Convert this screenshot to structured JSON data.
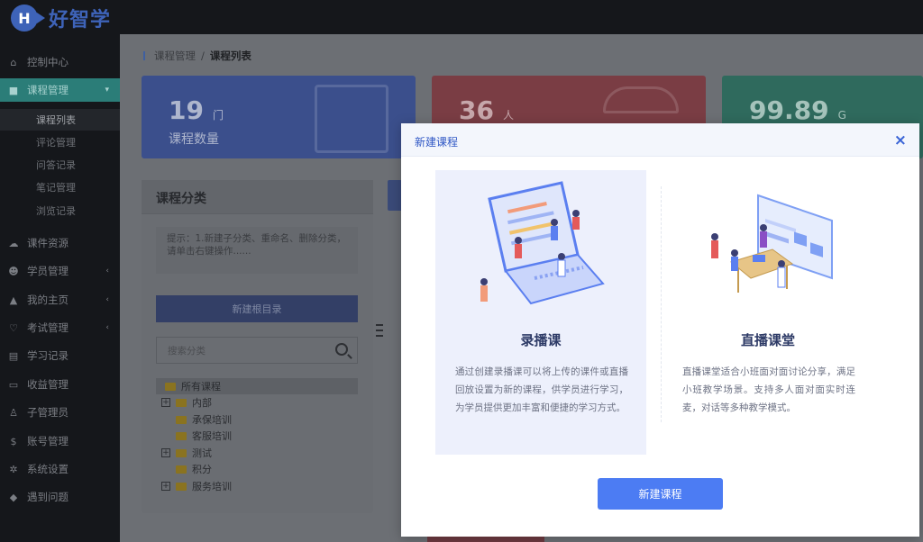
{
  "app": {
    "logo_letter": "H",
    "name": "好智学"
  },
  "sidebar": {
    "items": [
      {
        "icon": "home-icon",
        "label": "控制中心"
      },
      {
        "icon": "book-icon",
        "label": "课程管理"
      },
      {
        "icon": "cloud-icon",
        "label": "课件资源"
      },
      {
        "icon": "students-icon",
        "label": "学员管理"
      },
      {
        "icon": "graduation-icon",
        "label": "我的主页"
      },
      {
        "icon": "heart-icon",
        "label": "考试管理"
      },
      {
        "icon": "clipboard-icon",
        "label": "学习记录"
      },
      {
        "icon": "wallet-icon",
        "label": "收益管理"
      },
      {
        "icon": "user-icon",
        "label": "子管理员"
      },
      {
        "icon": "dollar-icon",
        "label": "账号管理"
      },
      {
        "icon": "gear-icon",
        "label": "系统设置"
      },
      {
        "icon": "question-icon",
        "label": "遇到问题"
      }
    ],
    "sub_items": [
      "课程列表",
      "评论管理",
      "问答记录",
      "笔记管理",
      "浏览记录"
    ]
  },
  "breadcrumb": {
    "parent": "课程管理",
    "separator": "/",
    "current": "课程列表"
  },
  "stats": [
    {
      "value": "19",
      "unit": "门",
      "label": "课程数量"
    },
    {
      "value": "36",
      "unit": "人",
      "label": ""
    },
    {
      "value": "99.89",
      "unit": "G",
      "label": ""
    }
  ],
  "category_panel": {
    "title": "课程分类",
    "tip": "提示：1.新建子分类、重命名、删除分类，请单击右键操作......",
    "root_button": "新建根目录",
    "search_placeholder": "搜索分类",
    "tree": [
      {
        "label": "所有课程",
        "expandable": false,
        "selected": true
      },
      {
        "label": "内部",
        "expandable": true,
        "selected": false
      },
      {
        "label": "承保培训",
        "expandable": false,
        "selected": false
      },
      {
        "label": "客服培训",
        "expandable": false,
        "selected": false
      },
      {
        "label": "测试",
        "expandable": true,
        "selected": false
      },
      {
        "label": "积分",
        "expandable": false,
        "selected": false
      },
      {
        "label": "服务培训",
        "expandable": true,
        "selected": false
      }
    ]
  },
  "modal": {
    "title": "新建课程",
    "close_symbol": "×",
    "options": [
      {
        "title": "录播课",
        "description": "通过创建录播课可以将上传的课件或直播回放设置为新的课程，供学员进行学习，为学员提供更加丰富和便捷的学习方式。"
      },
      {
        "title": "直播课堂",
        "description": "直播课堂适合小班面对面讨论分享，满足小班教学场景。支持多人面对面实时连麦，对话等多种教学模式。"
      }
    ],
    "confirm_button": "新建课程"
  }
}
